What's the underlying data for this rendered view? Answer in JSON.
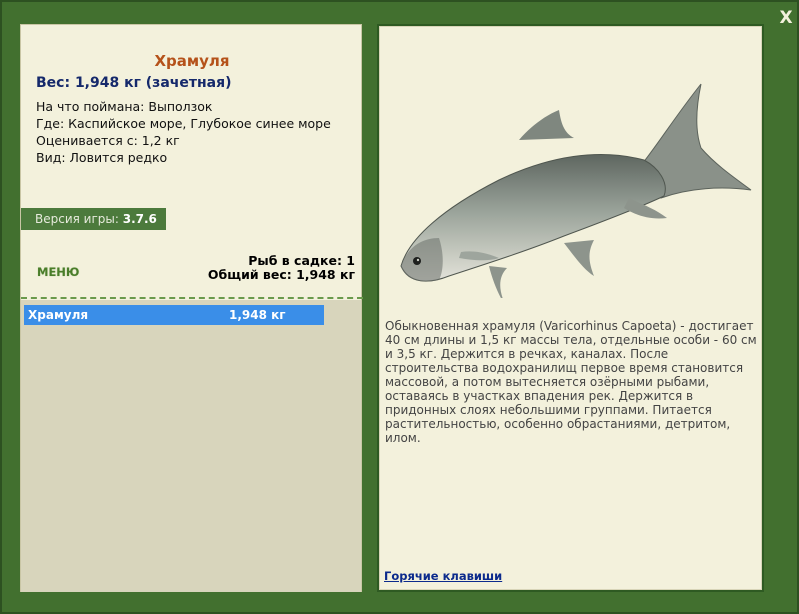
{
  "window": {
    "close_label": "X"
  },
  "fish": {
    "name": "Храмуля",
    "weight_line": "Вес: 1,948 кг (зачетная)",
    "caught_with": "На что поймана: Выползок",
    "where": "Где: Каспийское море, Глубокое синее море",
    "valued_from": "Оценивается с: 1,2 кг",
    "kind": "Вид: Ловится редко"
  },
  "version": {
    "label": "Версия игры:",
    "number": "3.7.6"
  },
  "menu": {
    "label": "МЕНЮ"
  },
  "cage": {
    "count_line": "Рыб в садке: 1",
    "total_line": "Общий вес: 1,948 кг"
  },
  "catch_list": [
    {
      "name": "Храмуля",
      "weight": "1,948 кг"
    }
  ],
  "description": "Обыкновенная храмуля (Varicorhinus Capoeta) - достигает 40 см длины и 1,5 кг массы тела, отдельные особи - 60 см и 3,5 кг. Держится в речках, каналах. После строительства водохранилищ первое время становится массовой, а потом вытесняется озёрными рыбами, оставаясь в участках впадения рек. Держится в придонных слоях небольшими группами. Питается растительностью, особенно обрастаниями, детритом, илом.",
  "hotkeys": {
    "label": "Горячие клавиши"
  },
  "colors": {
    "frame": "#42702f",
    "panel": "#f3f1dc",
    "title": "#b5521a",
    "weight": "#15296b",
    "selection": "#3a8ee8",
    "link": "#0b2a8c"
  }
}
